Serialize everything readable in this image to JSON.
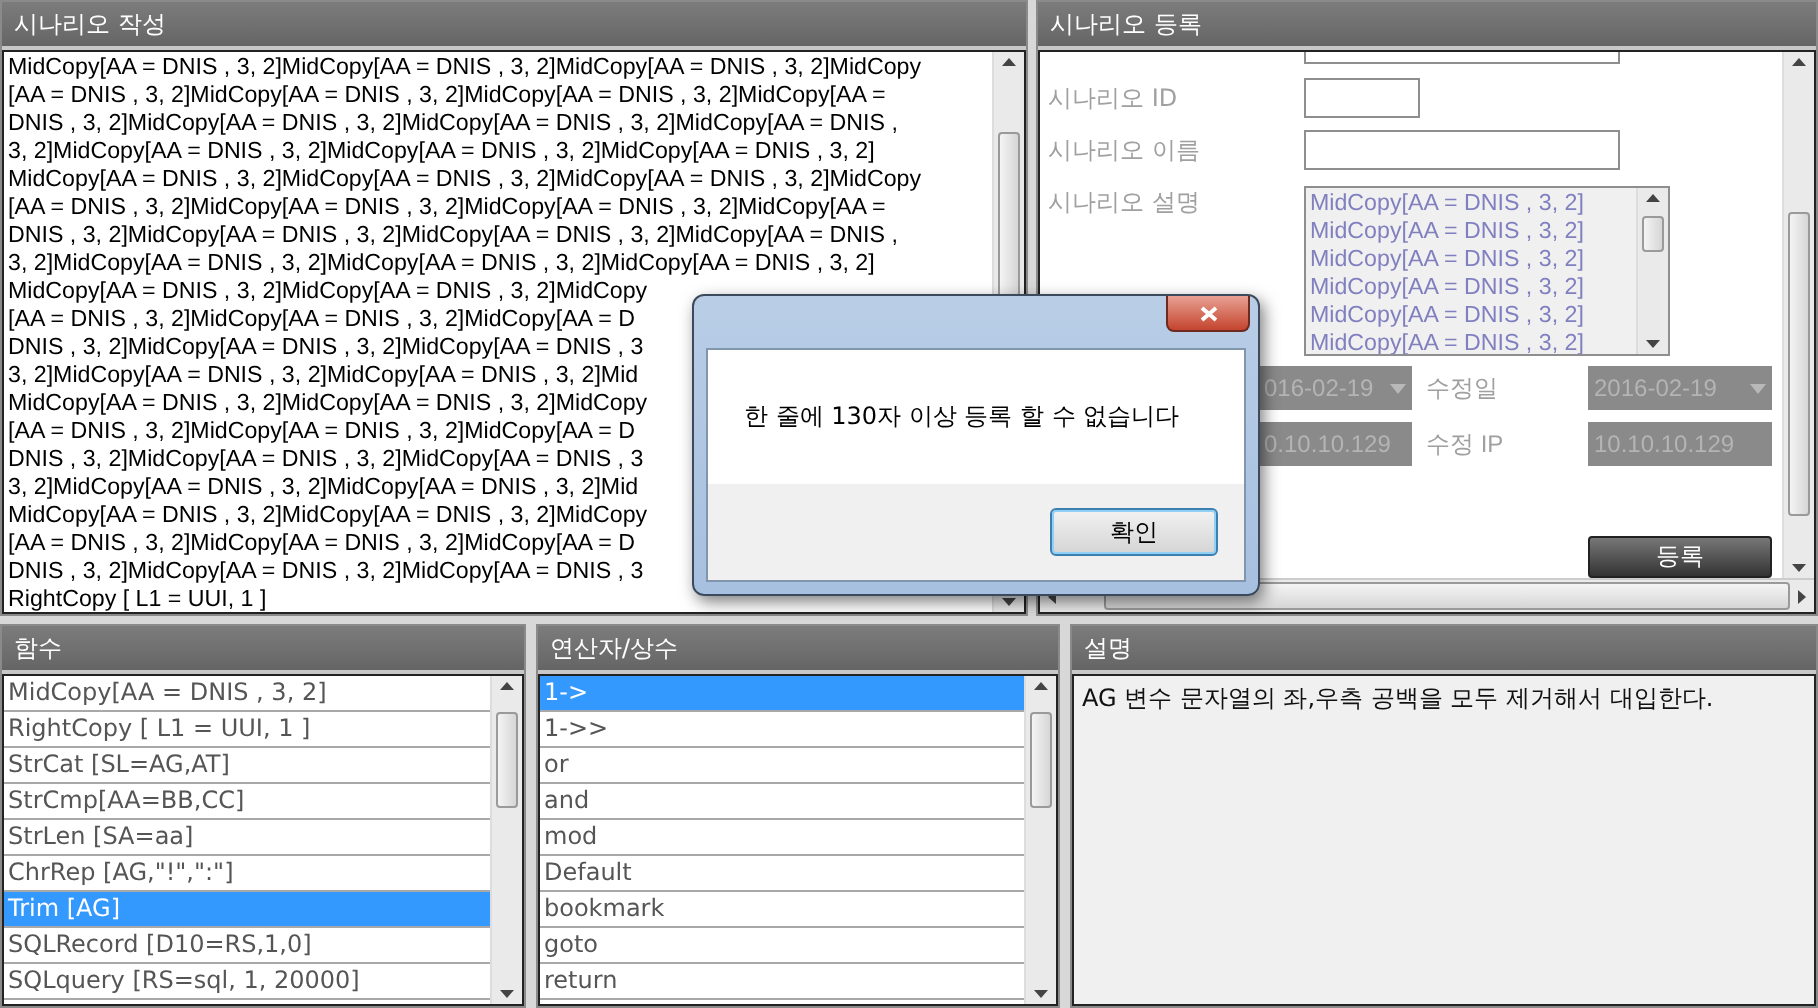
{
  "editor": {
    "title": "시나리오 작성",
    "lines": [
      "MidCopy[AA = DNIS , 3, 2]MidCopy[AA = DNIS , 3, 2]MidCopy[AA = DNIS , 3, 2]MidCopy",
      "[AA = DNIS , 3, 2]MidCopy[AA = DNIS , 3, 2]MidCopy[AA = DNIS , 3, 2]MidCopy[AA =",
      "DNIS , 3, 2]MidCopy[AA = DNIS , 3, 2]MidCopy[AA = DNIS , 3, 2]MidCopy[AA = DNIS ,",
      "3, 2]MidCopy[AA = DNIS , 3, 2]MidCopy[AA = DNIS , 3, 2]MidCopy[AA = DNIS , 3, 2]",
      "MidCopy[AA = DNIS , 3, 2]MidCopy[AA = DNIS , 3, 2]MidCopy[AA = DNIS , 3, 2]MidCopy",
      "[AA = DNIS , 3, 2]MidCopy[AA = DNIS , 3, 2]MidCopy[AA = DNIS , 3, 2]MidCopy[AA =",
      "DNIS , 3, 2]MidCopy[AA = DNIS , 3, 2]MidCopy[AA = DNIS , 3, 2]MidCopy[AA = DNIS ,",
      "3, 2]MidCopy[AA = DNIS , 3, 2]MidCopy[AA = DNIS , 3, 2]MidCopy[AA = DNIS , 3, 2]",
      "MidCopy[AA = DNIS , 3, 2]MidCopy[AA = DNIS , 3, 2]MidCopy",
      "[AA = DNIS , 3, 2]MidCopy[AA = DNIS , 3, 2]MidCopy[AA = D",
      "DNIS , 3, 2]MidCopy[AA = DNIS , 3, 2]MidCopy[AA = DNIS , 3",
      "3, 2]MidCopy[AA = DNIS , 3, 2]MidCopy[AA = DNIS , 3, 2]Mid",
      "MidCopy[AA = DNIS , 3, 2]MidCopy[AA = DNIS , 3, 2]MidCopy",
      "[AA = DNIS , 3, 2]MidCopy[AA = DNIS , 3, 2]MidCopy[AA = D",
      "DNIS , 3, 2]MidCopy[AA = DNIS , 3, 2]MidCopy[AA = DNIS , 3",
      "3, 2]MidCopy[AA = DNIS , 3, 2]MidCopy[AA = DNIS , 3, 2]Mid",
      "MidCopy[AA = DNIS , 3, 2]MidCopy[AA = DNIS , 3, 2]MidCopy",
      "[AA = DNIS , 3, 2]MidCopy[AA = DNIS , 3, 2]MidCopy[AA = D",
      "DNIS , 3, 2]MidCopy[AA = DNIS , 3, 2]MidCopy[AA = DNIS , 3",
      "RightCopy [ L1 = UUI, 1 ]"
    ]
  },
  "register": {
    "title": "시나리오 등록",
    "fields": [
      {
        "kind": "short",
        "label": "시나리오 ID"
      },
      {
        "kind": "long",
        "label": "시나리오 이름"
      },
      {
        "kind": "textarea",
        "label": "시나리오 설명",
        "lines": [
          "MidCopy[AA = DNIS , 3, 2]",
          "MidCopy[AA = DNIS , 3, 2]",
          "MidCopy[AA = DNIS , 3, 2]",
          "MidCopy[AA = DNIS , 3, 2]",
          "MidCopy[AA = DNIS , 3, 2]",
          "MidCopy[AA = DNIS , 3, 2]"
        ]
      }
    ],
    "meta_rows": [
      [
        {
          "kind": "date",
          "value": "016-02-19"
        },
        {
          "kind": "label",
          "text": "수정일"
        },
        {
          "kind": "date",
          "value": "2016-02-19"
        }
      ],
      [
        {
          "kind": "text",
          "value": "0.10.10.129"
        },
        {
          "kind": "label",
          "text": "수정 IP"
        },
        {
          "kind": "text",
          "value": "10.10.10.129"
        }
      ]
    ],
    "button": "등록"
  },
  "functions": {
    "title": "함수",
    "items": [
      {
        "label": "MidCopy[AA = DNIS , 3, 2]",
        "selected": false
      },
      {
        "label": "RightCopy [ L1 = UUI, 1 ]",
        "selected": false
      },
      {
        "label": "StrCat [SL=AG,AT]",
        "selected": false
      },
      {
        "label": "StrCmp[AA=BB,CC]",
        "selected": false
      },
      {
        "label": "StrLen [SA=aa]",
        "selected": false
      },
      {
        "label": "ChrRep [AG,\"!\",\":\"]",
        "selected": false
      },
      {
        "label": "Trim [AG]",
        "selected": true
      },
      {
        "label": "SQLRecord [D10=RS,1,0]",
        "selected": false
      },
      {
        "label": "SQLquery [RS=sql, 1, 20000]",
        "selected": false
      }
    ]
  },
  "operators": {
    "title": "연산자/상수",
    "items": [
      {
        "label": "1->",
        "selected": true
      },
      {
        "label": "1->>",
        "selected": false
      },
      {
        "label": "or",
        "selected": false
      },
      {
        "label": "and",
        "selected": false
      },
      {
        "label": "mod",
        "selected": false
      },
      {
        "label": "Default",
        "selected": false
      },
      {
        "label": "bookmark",
        "selected": false
      },
      {
        "label": "goto",
        "selected": false
      },
      {
        "label": "return",
        "selected": false
      }
    ]
  },
  "description": {
    "title": "설명",
    "text": "AG 변수 문자열의 좌,우측 공백을 모두 제거해서 대입한다."
  },
  "dialog": {
    "message": "한 줄에 130자 이상 등록 할 수 없습니다",
    "button": "확인"
  }
}
